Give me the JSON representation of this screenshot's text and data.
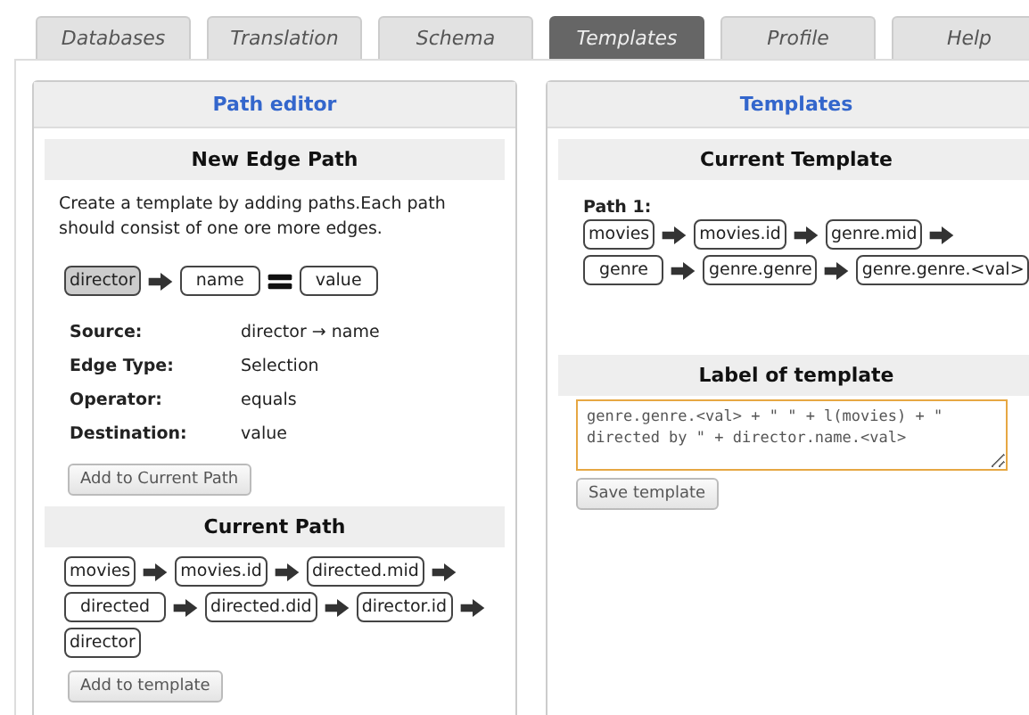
{
  "tabs": [
    {
      "label": "Databases",
      "selected": false
    },
    {
      "label": "Translation",
      "selected": false
    },
    {
      "label": "Schema",
      "selected": false
    },
    {
      "label": "Templates",
      "selected": true
    },
    {
      "label": "Profile",
      "selected": false
    },
    {
      "label": "Help",
      "selected": false
    }
  ],
  "path_editor": {
    "title": "Path editor",
    "new_edge_path": {
      "title": "New Edge Path",
      "description": "Create a template by adding paths.Each path should consist of one ore more edges.",
      "items": [
        {
          "kind": "node",
          "text": "director",
          "selected": true
        },
        {
          "kind": "arrow"
        },
        {
          "kind": "node",
          "text": "name",
          "selected": false
        },
        {
          "kind": "equals"
        },
        {
          "kind": "node",
          "text": "value",
          "selected": false
        }
      ],
      "details": [
        {
          "label": "Source:",
          "value": "director → name"
        },
        {
          "label": "Edge Type:",
          "value": "Selection"
        },
        {
          "label": "Operator:",
          "value": "equals"
        },
        {
          "label": "Destination:",
          "value": "value"
        }
      ],
      "button": "Add to Current Path"
    },
    "current_path": {
      "title": "Current Path",
      "rows": [
        [
          "movies",
          "movies.id",
          "directed.mid"
        ],
        [
          "directed",
          "directed.did",
          "director.id"
        ],
        [
          "director"
        ]
      ],
      "button": "Add to template"
    }
  },
  "templates": {
    "title": "Templates",
    "current_template": {
      "title": "Current Template",
      "path_label": "Path 1:",
      "rows": [
        [
          "movies",
          "movies.id",
          "genre.mid"
        ],
        [
          "genre",
          "genre.genre",
          "genre.genre.<val>"
        ]
      ]
    },
    "label_of_template": {
      "title": "Label of template",
      "value": "genre.genre.<val> + \" \" + l(movies) + \" directed by \" + director.name.<val>",
      "button": "Save template"
    }
  }
}
